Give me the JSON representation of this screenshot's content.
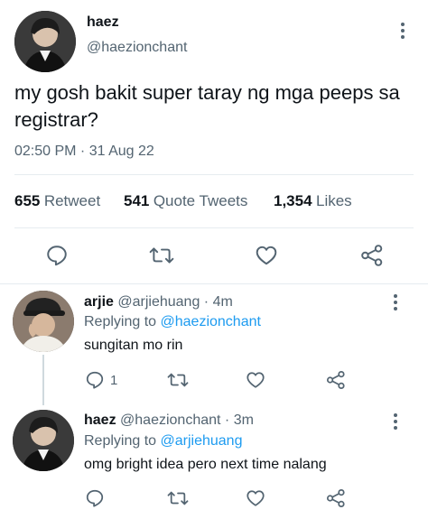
{
  "main_tweet": {
    "name": "haez",
    "handle": "@haezionchant",
    "text": "my gosh bakit super taray ng mga peeps sa registrar?",
    "timestamp": "02:50 PM · 31 Aug 22",
    "stats": {
      "retweets_count": "655",
      "retweets_label": "Retweet",
      "quotes_count": "541",
      "quotes_label": "Quote Tweets",
      "likes_count": "1,354",
      "likes_label": "Likes"
    },
    "actions": [
      "reply-icon",
      "retweet-icon",
      "like-icon",
      "share-icon"
    ]
  },
  "replies": [
    {
      "name": "arjie",
      "handle": "@arjiehuang",
      "time": "· 4m",
      "replying_prefix": "Replying to",
      "replying_to": "@haezionchant",
      "text": "sungitan mo rin",
      "reply_count": "1"
    },
    {
      "name": "haez",
      "handle": "@haezionchant",
      "time": "· 3m",
      "replying_prefix": "Replying to",
      "replying_to": "@arjiehuang",
      "text": "omg bright idea pero next time nalang",
      "reply_count": ""
    }
  ],
  "colors": {
    "text": "#0f1419",
    "secondary": "#536471",
    "link": "#1d9bf0",
    "divider": "#e6ecf0"
  }
}
